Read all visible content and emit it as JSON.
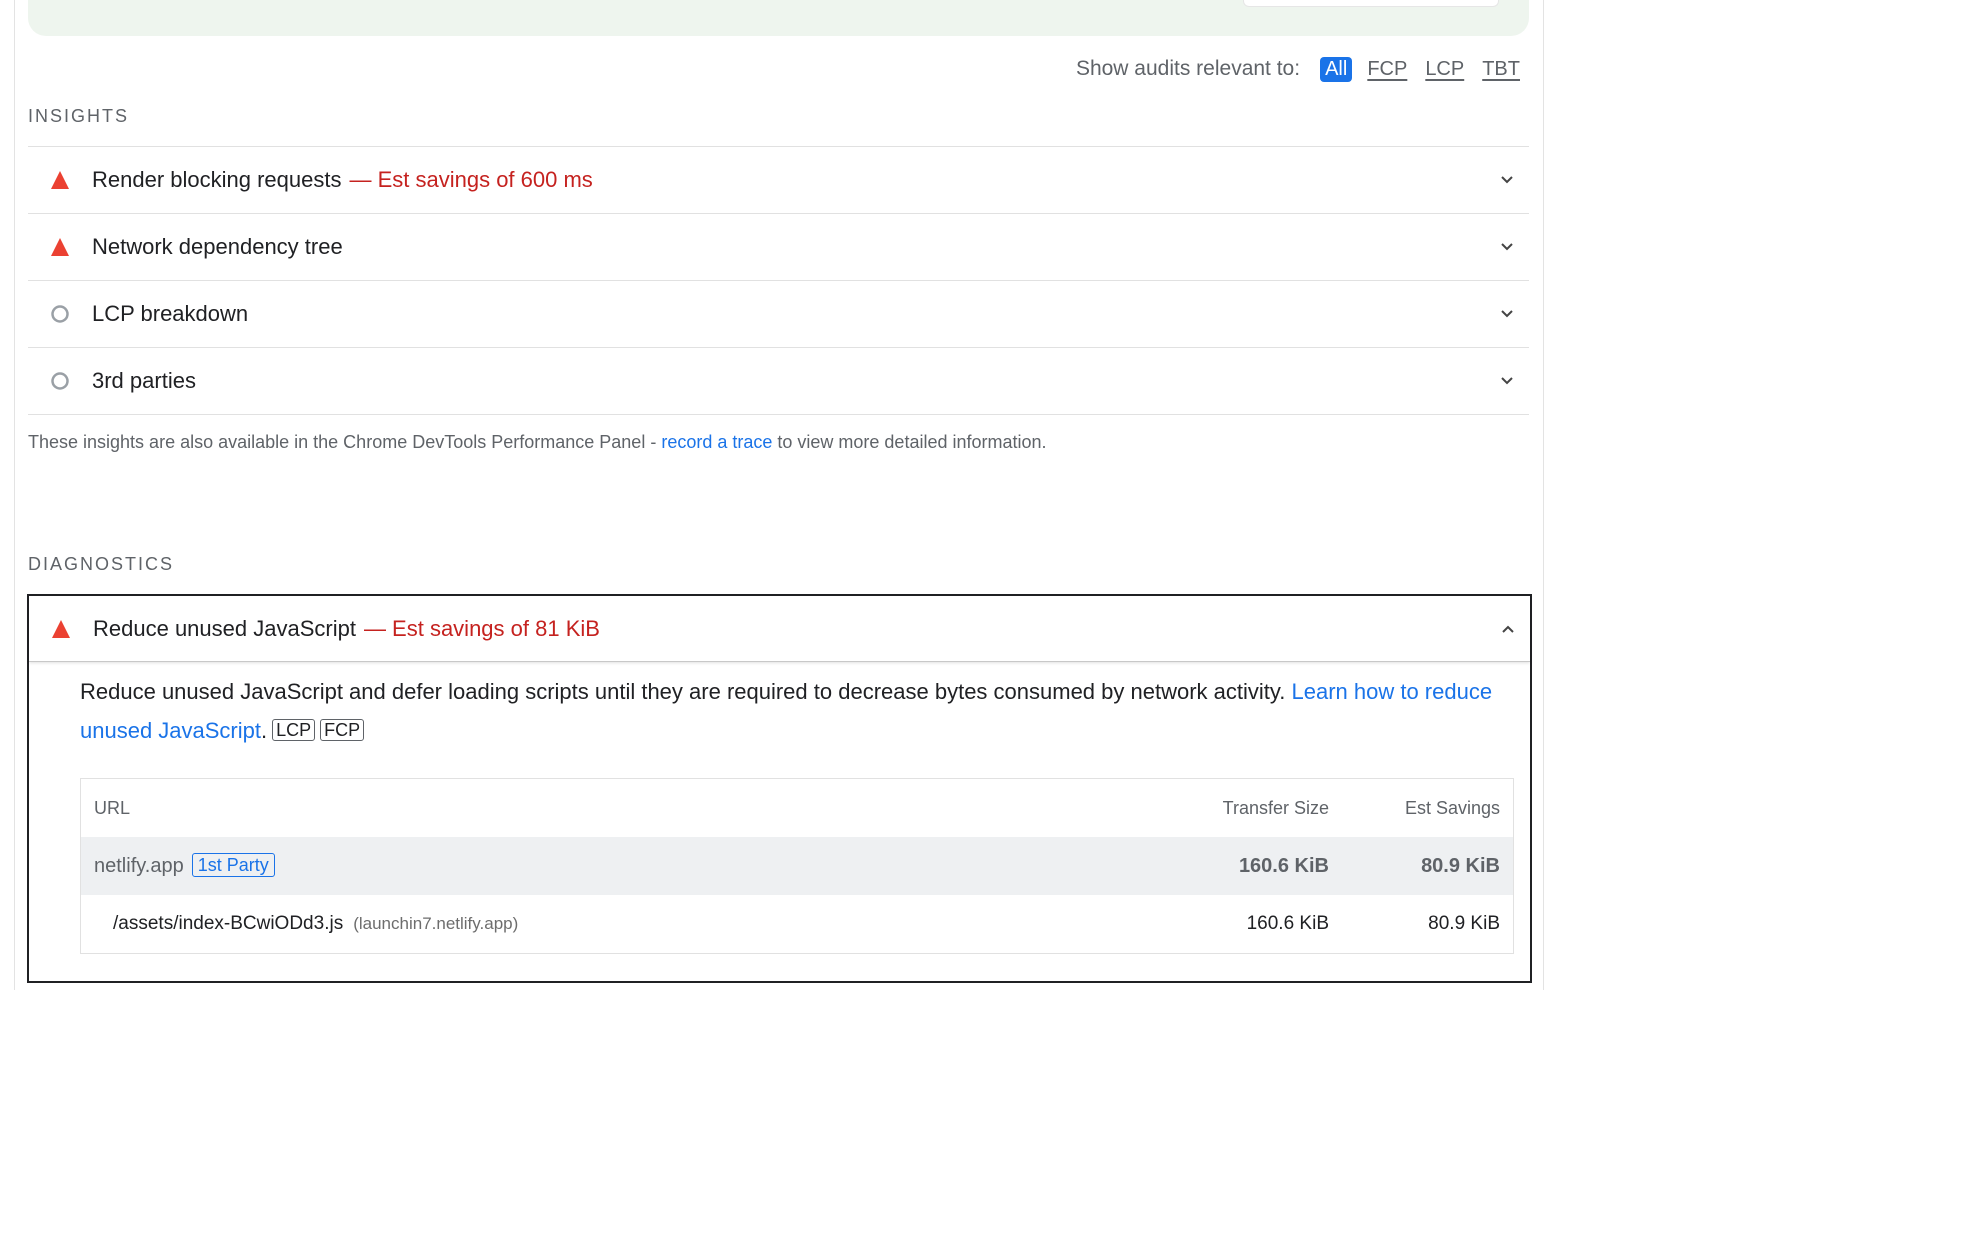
{
  "filter": {
    "label": "Show audits relevant to:",
    "chips": [
      "All",
      "FCP",
      "LCP",
      "TBT"
    ],
    "active": "All"
  },
  "insights": {
    "title": "INSIGHTS",
    "items": [
      {
        "title": "Render blocking requests",
        "savings": "— Est savings of 600 ms",
        "status": "fail"
      },
      {
        "title": "Network dependency tree",
        "savings": "",
        "status": "fail"
      },
      {
        "title": "LCP breakdown",
        "savings": "",
        "status": "informative"
      },
      {
        "title": "3rd parties",
        "savings": "",
        "status": "informative"
      }
    ],
    "note": {
      "prefix": "These insights are also available in the Chrome DevTools Performance Panel - ",
      "link": "record a trace",
      "suffix": " to view more detailed information."
    }
  },
  "diagnostics": {
    "title": "DIAGNOSTICS",
    "item": {
      "title": "Reduce unused JavaScript",
      "savings": "— Est savings of 81 KiB",
      "status": "fail",
      "description": "Reduce unused JavaScript and defer loading scripts until they are required to decrease bytes consumed by network activity. ",
      "learn_link": "Learn how to reduce unused JavaScript",
      "tags": [
        "LCP",
        "FCP"
      ],
      "table": {
        "headers": {
          "url": "URL",
          "transfer_size": "Transfer Size",
          "est_savings": "Est Savings"
        },
        "group": {
          "entity": "netlify.app",
          "badge": "1st Party",
          "transfer_size": "160.6 KiB",
          "est_savings": "80.9 KiB"
        },
        "rows": [
          {
            "url": "/assets/index-BCwiODd3.js",
            "host": "(launchin7.netlify.app)",
            "transfer_size": "160.6 KiB",
            "est_savings": "80.9 KiB"
          }
        ]
      }
    }
  },
  "colors": {
    "fail": "#eb4132",
    "informative": "#9aa0a6",
    "link": "#1a73e8",
    "savings": "#c5221f",
    "active_chip": "#1a73e8"
  }
}
